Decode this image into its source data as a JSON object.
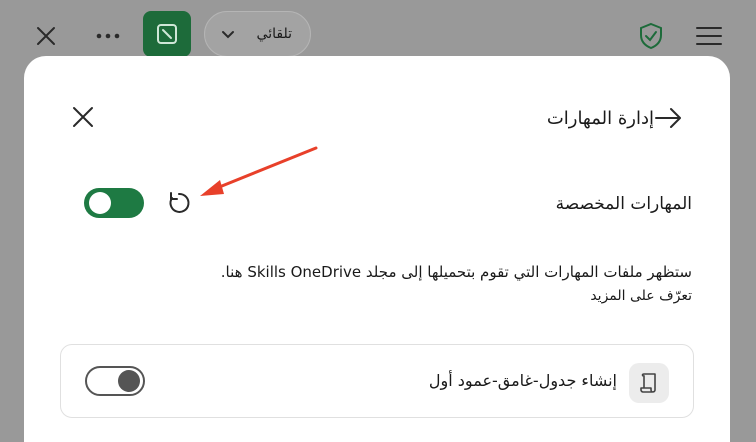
{
  "topbar": {
    "mode_label": "تلقائي",
    "icons": {
      "close": "close-icon",
      "more": "more-icon",
      "edit": "edit-icon",
      "dropdown": "chevron-down-icon",
      "shield": "shield-check-icon",
      "menu": "hamburger-icon"
    },
    "accent_color": "#1d6b3a"
  },
  "panel": {
    "title": "إدارة المهارات",
    "custom_skills": {
      "label": "المهارات المخصصة",
      "toggle_state": "on",
      "toggle_color": "#1e7a43"
    },
    "description": "ستظهر ملفات المهارات التي تقوم بتحميلها إلى مجلد Skills OneDrive هنا.",
    "learn_more": "تعرّف على المزيد",
    "skills": [
      {
        "label": "إنشاء جدول-غامق-عمود أول",
        "toggle_state": "off",
        "icon": "scroll-icon"
      }
    ]
  },
  "annotation": {
    "arrow_color": "#e8402a"
  }
}
